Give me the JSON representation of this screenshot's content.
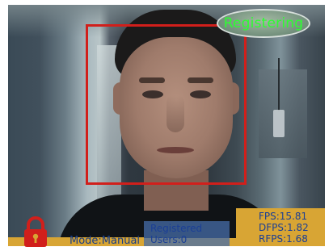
{
  "overlay": {
    "status_badge": "Registering",
    "mode_label": "Mode:Manual",
    "registered": {
      "title": "Registered",
      "users": "Users:0"
    },
    "stats": {
      "fps": "FPS:15.81",
      "dfps": "DFPS:1.82",
      "rfps": "RFPS:1.68"
    },
    "icons": {
      "lock": "lock-icon"
    }
  },
  "colors": {
    "face_box": "#d11f1b",
    "badge_text": "#2cff30",
    "panel_gold": "#d8a534",
    "panel_blue": "#466eaa",
    "label_text": "#1b3f95",
    "lock_red": "#d11f1b"
  }
}
